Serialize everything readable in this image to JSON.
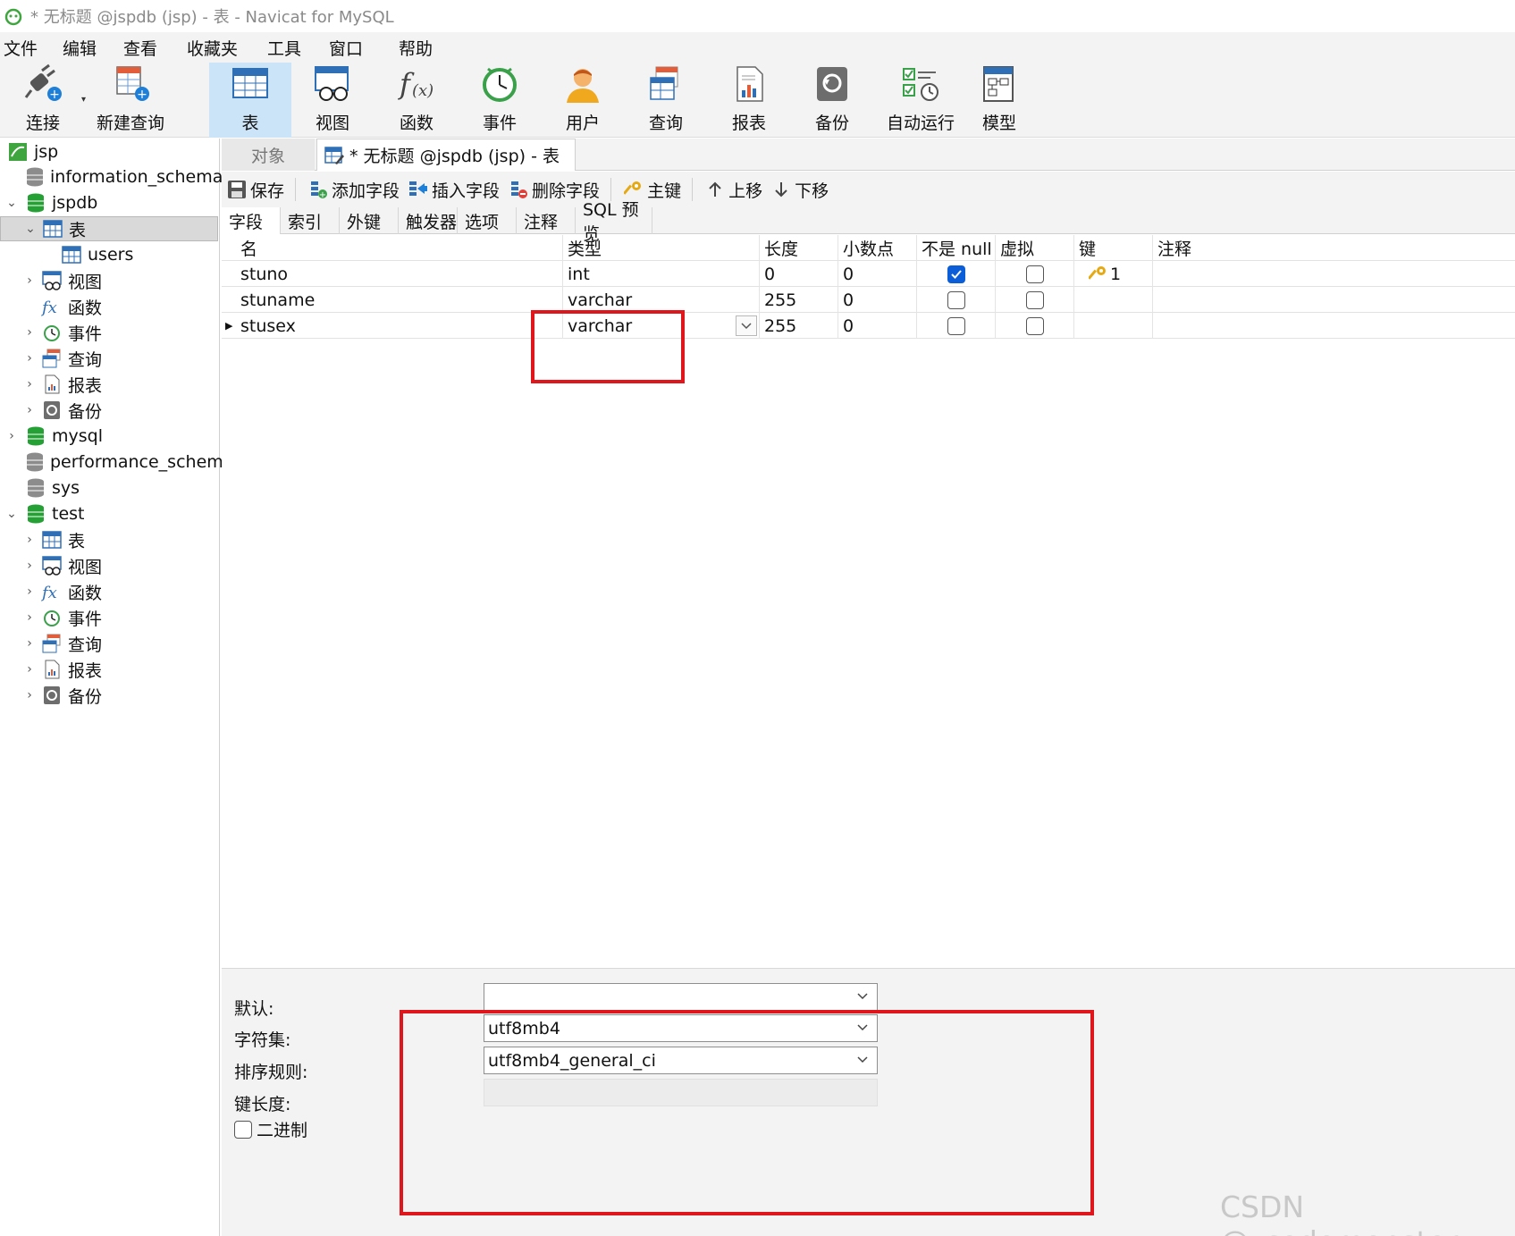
{
  "window": {
    "title": "* 无标题 @jspdb (jsp) - 表 - Navicat for MySQL"
  },
  "menu": {
    "items": [
      "文件",
      "编辑",
      "查看",
      "收藏夹",
      "工具",
      "窗口",
      "帮助"
    ]
  },
  "toolbar": {
    "buttons": [
      {
        "label": "连接",
        "icon": "plug-icon"
      },
      {
        "label": "新建查询",
        "icon": "new-query-icon"
      },
      {
        "label": "表",
        "icon": "table-icon"
      },
      {
        "label": "视图",
        "icon": "view-icon"
      },
      {
        "label": "函数",
        "icon": "function-icon"
      },
      {
        "label": "事件",
        "icon": "clock-icon"
      },
      {
        "label": "用户",
        "icon": "user-icon"
      },
      {
        "label": "查询",
        "icon": "query-icon"
      },
      {
        "label": "报表",
        "icon": "report-icon"
      },
      {
        "label": "备份",
        "icon": "backup-icon"
      },
      {
        "label": "自动运行",
        "icon": "schedule-icon"
      },
      {
        "label": "模型",
        "icon": "model-icon"
      }
    ]
  },
  "sidebar": {
    "connection": "jsp",
    "nodes": [
      {
        "label": "information_schema"
      },
      {
        "label": "jspdb"
      },
      {
        "label": "表"
      },
      {
        "label": "users"
      },
      {
        "label": "视图"
      },
      {
        "label": "函数"
      },
      {
        "label": "事件"
      },
      {
        "label": "查询"
      },
      {
        "label": "报表"
      },
      {
        "label": "备份"
      },
      {
        "label": "mysql"
      },
      {
        "label": "performance_schema"
      },
      {
        "label": "sys"
      },
      {
        "label": "test"
      },
      {
        "label": "表"
      },
      {
        "label": "视图"
      },
      {
        "label": "函数"
      },
      {
        "label": "事件"
      },
      {
        "label": "查询"
      },
      {
        "label": "报表"
      },
      {
        "label": "备份"
      }
    ]
  },
  "tabs": {
    "objects": "对象",
    "current": "* 无标题 @jspdb (jsp) - 表"
  },
  "edit_toolbar": {
    "save": "保存",
    "add_field": "添加字段",
    "insert_field": "插入字段",
    "delete_field": "删除字段",
    "primary_key": "主键",
    "move_up": "上移",
    "move_down": "下移"
  },
  "subtabs": [
    "字段",
    "索引",
    "外键",
    "触发器",
    "选项",
    "注释",
    "SQL 预览"
  ],
  "grid": {
    "headers": [
      "名",
      "类型",
      "长度",
      "小数点",
      "不是 null",
      "虚拟",
      "键",
      "注释"
    ],
    "rows": [
      {
        "name": "stuno",
        "type": "int",
        "length": "0",
        "decimals": "0",
        "not_null": true,
        "virtual": false,
        "key": "1"
      },
      {
        "name": "stuname",
        "type": "varchar",
        "length": "255",
        "decimals": "0",
        "not_null": false,
        "virtual": false,
        "key": ""
      },
      {
        "name": "stusex",
        "type": "varchar",
        "length": "255",
        "decimals": "0",
        "not_null": false,
        "virtual": false,
        "key": ""
      }
    ]
  },
  "properties": {
    "default_label": "默认:",
    "default_value": "",
    "charset_label": "字符集:",
    "charset_value": "utf8mb4",
    "collation_label": "排序规则:",
    "collation_value": "utf8mb4_general_ci",
    "key_length_label": "键长度:",
    "binary_label": "二进制"
  },
  "watermark": "CSDN @_codemonster",
  "colors": {
    "annotation": "#e0161d",
    "selection": "#cce4f7",
    "checkbox_checked": "#0b5ed7"
  }
}
